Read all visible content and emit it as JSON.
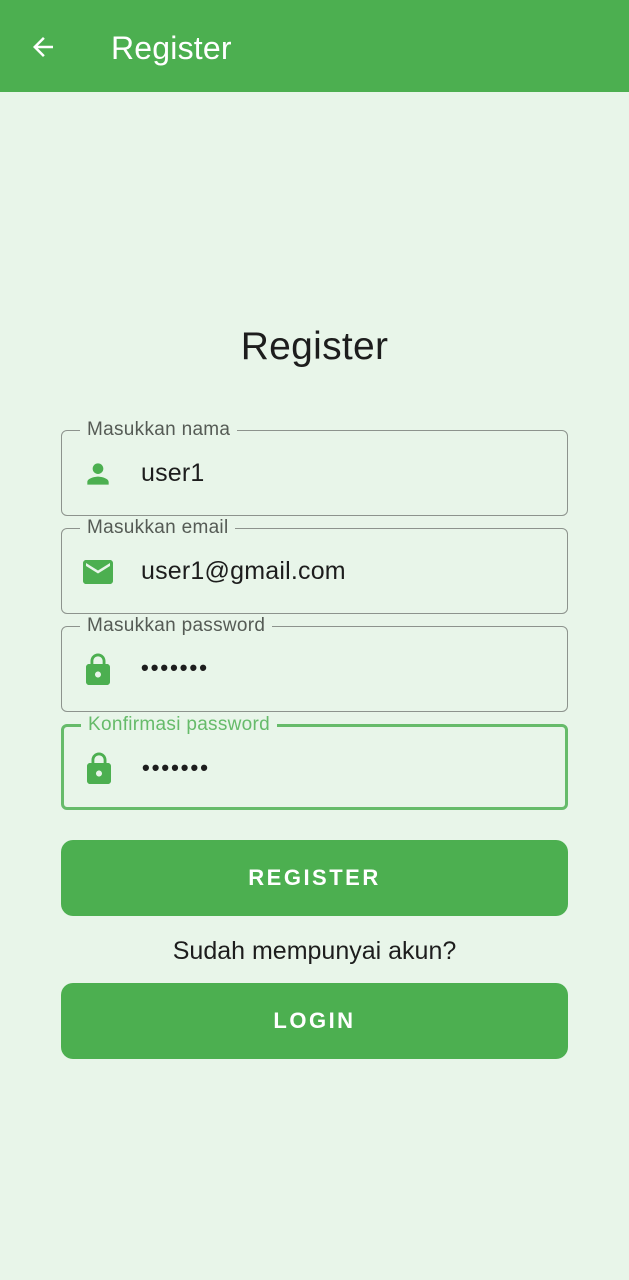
{
  "appbar": {
    "title": "Register",
    "back_icon": "arrow-back-icon"
  },
  "form": {
    "title": "Register",
    "fields": [
      {
        "label": "Masukkan nama",
        "value": "user1",
        "icon": "person-icon"
      },
      {
        "label": "Masukkan email",
        "value": "user1@gmail.com",
        "icon": "email-icon"
      },
      {
        "label": "Masukkan password",
        "value": "•••••••",
        "icon": "lock-icon"
      },
      {
        "label": "Konfirmasi password",
        "value": "•••••••",
        "icon": "lock-icon"
      }
    ],
    "register_label": "REGISTER",
    "prompt": "Sudah mempunyai akun?",
    "login_label": "LOGIN"
  },
  "colors": {
    "primary": "#4caf50",
    "background": "#e8f5e9",
    "focused_outline": "#66bb6a",
    "outline": "#8d938d"
  }
}
